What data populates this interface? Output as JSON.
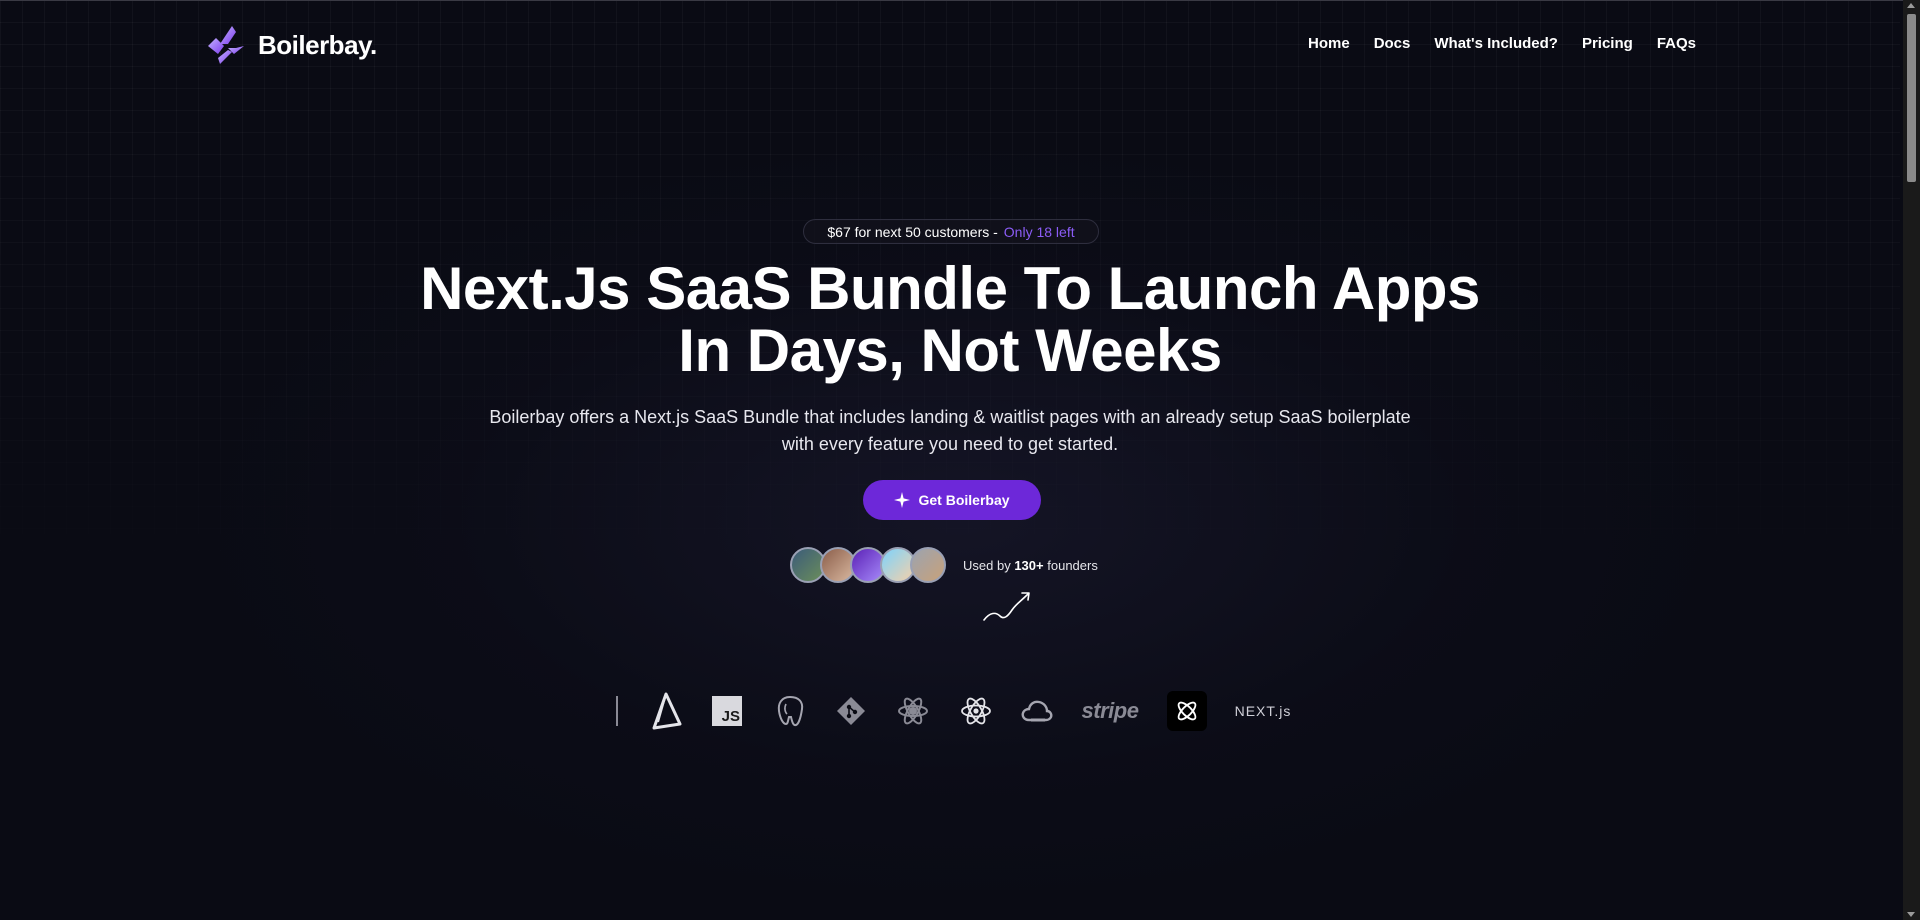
{
  "header": {
    "logo_text": "Boilerbay.",
    "nav": [
      "Home",
      "Docs",
      "What's Included?",
      "Pricing",
      "FAQs"
    ]
  },
  "hero": {
    "promo_text": "$67 for next 50 customers -",
    "promo_accent": "Only 18 left",
    "headline_line1": "Next.Js SaaS Bundle To Launch Apps",
    "headline_line2": "In Days, Not Weeks",
    "subtitle_line1": "Boilerbay offers a Next.js SaaS Bundle that includes landing & waitlist pages with an already setup SaaS boilerplate",
    "subtitle_line2": "with every feature you need to get started.",
    "cta_label": "Get Boilerbay",
    "social_prefix": "Used by",
    "social_count": "130+",
    "social_suffix": "founders"
  },
  "tech_logos": [
    "prisma-icon",
    "javascript-icon",
    "postgresql-icon",
    "git-icon",
    "react-query-icon",
    "react-icon",
    "cloud-icon",
    "stripe-icon",
    "atom-icon",
    "nextjs-icon"
  ],
  "tech_logo_text": {
    "javascript": "JS",
    "stripe": "stripe",
    "nextjs": "NEXT.js"
  },
  "colors": {
    "background": "#0a0b14",
    "accent": "#6d28d9",
    "accent_text": "#8b5cf6"
  }
}
